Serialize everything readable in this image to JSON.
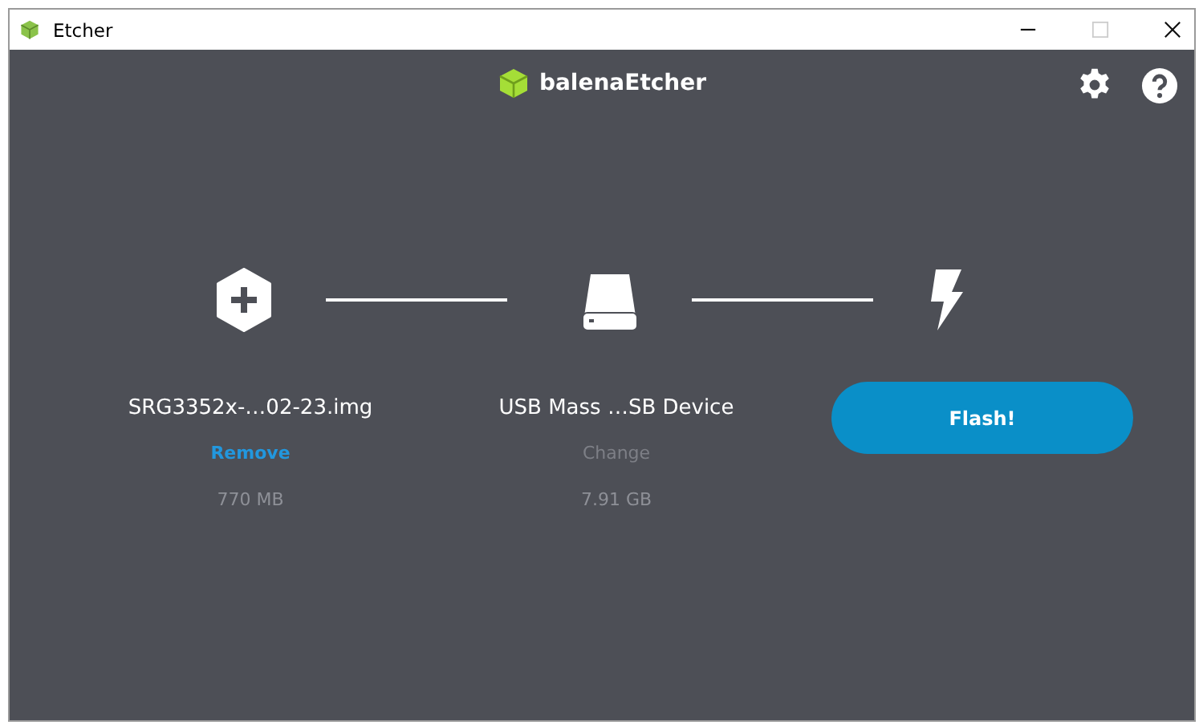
{
  "window": {
    "title": "Etcher",
    "controls": [
      {
        "kind": "minimize",
        "disabled": false
      },
      {
        "kind": "maximize",
        "disabled": true
      },
      {
        "kind": "close",
        "disabled": false
      }
    ]
  },
  "header": {
    "logo": "balena**Etcher**"
  },
  "steps": [
    {
      "kind": "image",
      "name": "SRG3352x-…02-23.img",
      "action": "Remove",
      "action_disabled": false,
      "size": "770 MB"
    },
    {
      "kind": "drive",
      "name": "USB Mass …SB Device",
      "action": "Change",
      "action_disabled": true,
      "size": "7.91 GB"
    },
    {
      "kind": "flash",
      "button": "Flash!",
      "disabled": false
    }
  ]
}
